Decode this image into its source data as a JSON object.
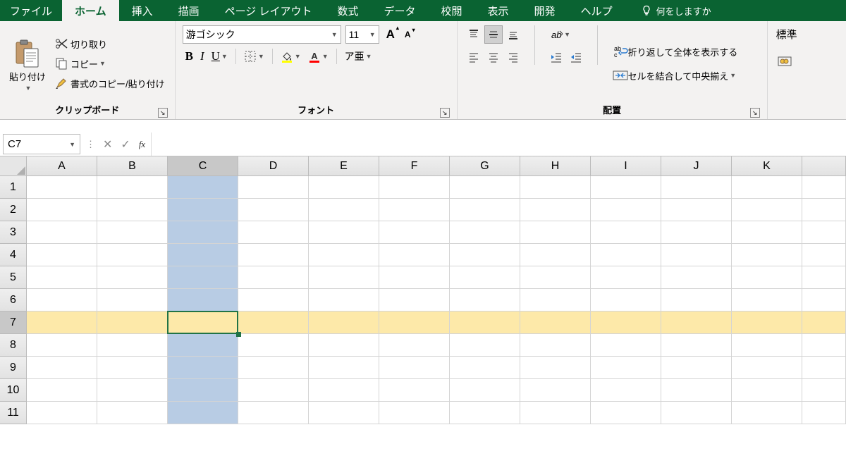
{
  "tabs": {
    "file": "ファイル",
    "home": "ホーム",
    "insert": "挿入",
    "draw": "描画",
    "page_layout": "ページ レイアウト",
    "formulas": "数式",
    "data": "データ",
    "review": "校閲",
    "view": "表示",
    "developer": "開発",
    "help": "ヘルプ",
    "tell_me": "何をしますか"
  },
  "clipboard": {
    "paste": "貼り付け",
    "cut": "切り取り",
    "copy": "コピー",
    "format_painter": "書式のコピー/貼り付け",
    "group": "クリップボード"
  },
  "font": {
    "name": "游ゴシック",
    "size": "11",
    "ruby": "ア亜",
    "group": "フォント"
  },
  "alignment": {
    "wrap": "折り返して全体を表示する",
    "merge": "セルを結合して中央揃え",
    "group": "配置"
  },
  "number": {
    "format": "標準"
  },
  "formula_bar": {
    "name_box": "C7",
    "fx": "fx"
  },
  "grid": {
    "columns": [
      "A",
      "B",
      "C",
      "D",
      "E",
      "F",
      "G",
      "H",
      "I",
      "J",
      "K"
    ],
    "rows": [
      "1",
      "2",
      "3",
      "4",
      "5",
      "6",
      "7",
      "8",
      "9",
      "10",
      "11"
    ],
    "selected_col": "C",
    "selected_row": "7",
    "active_cell": "C7"
  }
}
